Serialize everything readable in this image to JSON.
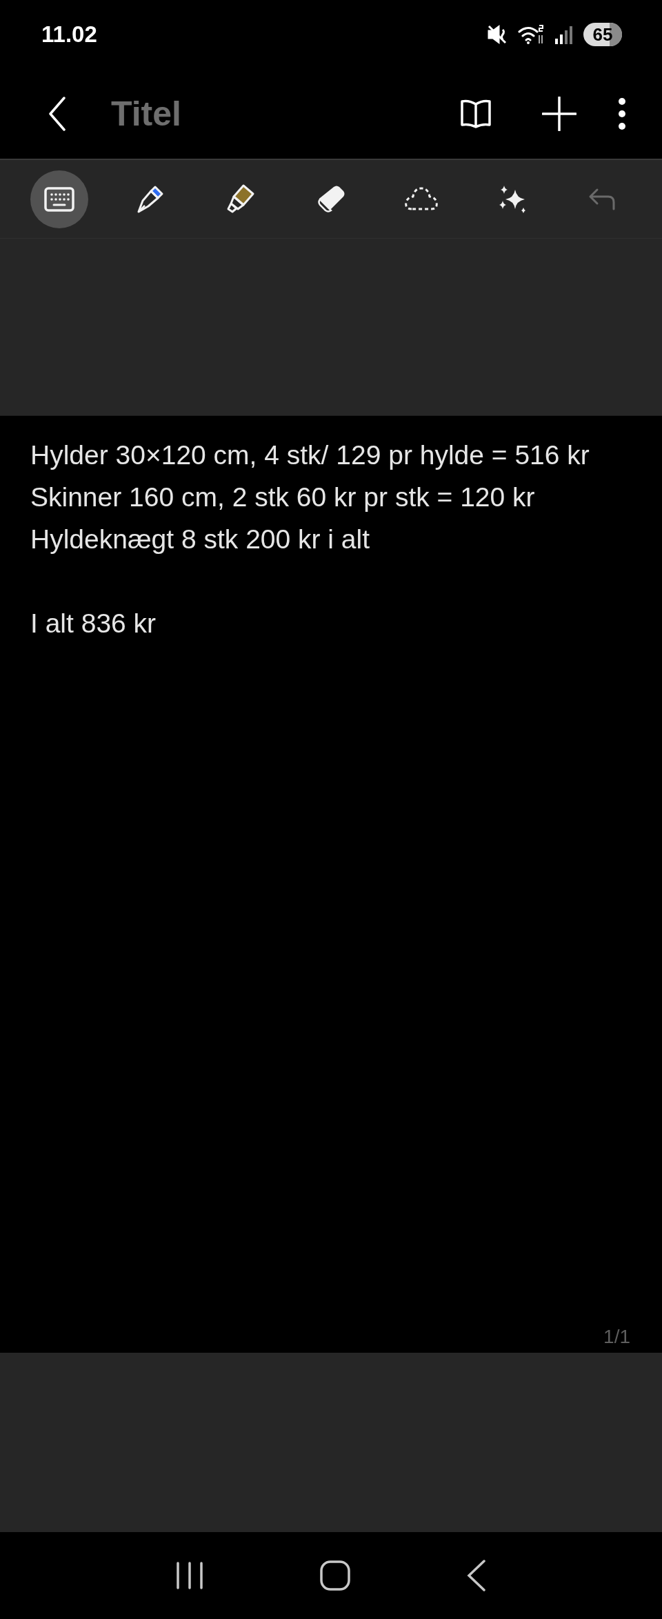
{
  "status_bar": {
    "time": "11.02",
    "battery": "65"
  },
  "header": {
    "title": "Titel"
  },
  "toolbar": [
    {
      "kind": "keyboard",
      "selected": true,
      "disabled": false
    },
    {
      "kind": "pen",
      "selected": false,
      "disabled": false
    },
    {
      "kind": "highlighter",
      "selected": false,
      "disabled": false
    },
    {
      "kind": "eraser",
      "selected": false,
      "disabled": false
    },
    {
      "kind": "lasso",
      "selected": false,
      "disabled": false
    },
    {
      "kind": "ai",
      "selected": false,
      "disabled": false
    },
    {
      "kind": "undo",
      "selected": false,
      "disabled": true
    }
  ],
  "note": {
    "paragraphs": [
      [
        "Hylder 30×120 cm, 4 stk/ 129 pr hylde = 516 kr",
        "Skinner 160 cm, 2 stk 60 kr pr stk = 120 kr",
        "Hyldeknægt 8 stk 200 kr i alt"
      ],
      [
        "I alt 836 kr"
      ]
    ]
  },
  "page_indicator": "1/1"
}
